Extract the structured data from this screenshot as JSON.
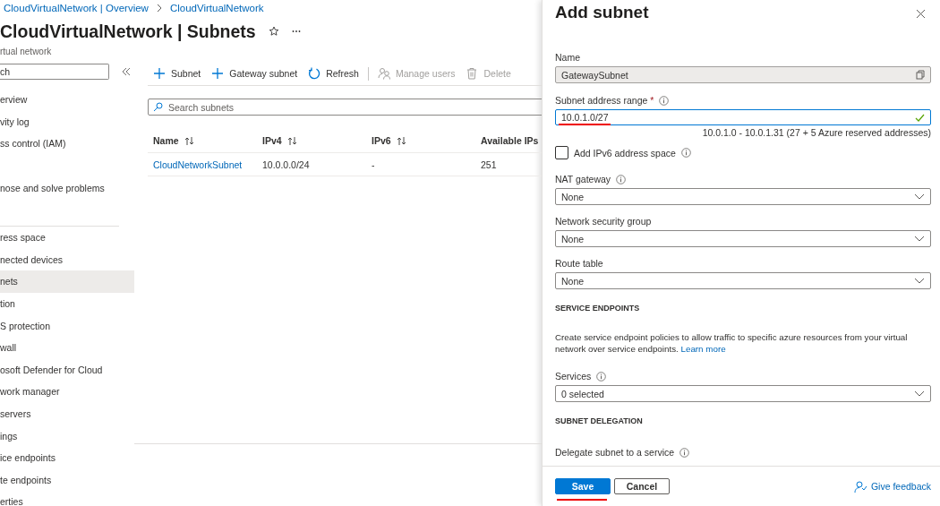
{
  "breadcrumb": [
    {
      "label": "CloudVirtualNetwork | Overview"
    },
    {
      "label": "CloudVirtualNetwork"
    }
  ],
  "page": {
    "title": "CloudVirtualNetwork | Subnets",
    "subtitle": "rtual network"
  },
  "sidebar": {
    "search": {
      "placeholder": "ch"
    },
    "groups": [
      [
        {
          "label": "erview",
          "selected": false
        },
        {
          "label": "vity log",
          "selected": false
        },
        {
          "label": "ss control (IAM)",
          "selected": false
        },
        {
          "label": "nose and solve problems",
          "selected": false
        }
      ],
      [
        {
          "label": "ress space",
          "selected": false
        },
        {
          "label": "nected devices",
          "selected": false
        },
        {
          "label": "nets",
          "selected": true
        },
        {
          "label": "tion",
          "selected": false
        },
        {
          "label": "S protection",
          "selected": false
        },
        {
          "label": "wall",
          "selected": false
        },
        {
          "label": "osoft Defender for Cloud",
          "selected": false
        },
        {
          "label": "work manager",
          "selected": false
        },
        {
          "label": " servers",
          "selected": false
        },
        {
          "label": "ings",
          "selected": false
        },
        {
          "label": "ice endpoints",
          "selected": false
        },
        {
          "label": "te endpoints",
          "selected": false
        },
        {
          "label": "erties",
          "selected": false
        }
      ]
    ]
  },
  "toolbar": [
    {
      "kind": "add",
      "label": "Subnet",
      "disabled": false
    },
    {
      "kind": "add",
      "label": "Gateway subnet",
      "disabled": false
    },
    {
      "kind": "refresh",
      "label": "Refresh",
      "disabled": false
    },
    {
      "kind": "users",
      "label": "Manage users",
      "disabled": true
    },
    {
      "kind": "delete",
      "label": "Delete",
      "disabled": true
    }
  ],
  "search": {
    "placeholder": "Search subnets"
  },
  "table": {
    "columns": [
      "Name",
      "IPv4",
      "IPv6",
      "Available IPs"
    ],
    "rows": [
      [
        "CloudNetworkSubnet",
        "10.0.0.0/24",
        "-",
        "251"
      ]
    ]
  },
  "panel": {
    "title": "Add subnet",
    "fields": [
      {
        "kind": "readonly",
        "label": "Name",
        "value": "GatewaySubnet"
      },
      {
        "kind": "text",
        "label": "Subnet address range",
        "required_mark": "*",
        "info": true,
        "value": "10.0.1.0/27",
        "valid": true,
        "marked": true,
        "hint": "10.0.1.0 - 10.0.1.31 (27 + 5 Azure reserved addresses)"
      },
      {
        "kind": "checkbox",
        "label": "Add IPv6 address space",
        "checked": false,
        "info": true
      },
      {
        "kind": "select",
        "label": "NAT gateway",
        "info": true,
        "value": "None"
      },
      {
        "kind": "select",
        "label": "Network security group",
        "info": false,
        "value": "None"
      },
      {
        "kind": "select",
        "label": "Route table",
        "info": false,
        "value": "None"
      },
      {
        "kind": "heading",
        "label": "SERVICE ENDPOINTS"
      },
      {
        "kind": "paragraph",
        "text": "Create service endpoint policies to allow traffic to specific azure resources from your virtual network over service endpoints.",
        "link": "Learn more"
      },
      {
        "kind": "select",
        "label": "Services",
        "info": true,
        "value": "0 selected"
      },
      {
        "kind": "heading",
        "label": "SUBNET DELEGATION"
      },
      {
        "kind": "label",
        "label": "Delegate subnet to a service",
        "info": true
      }
    ],
    "buttons": [
      {
        "kind": "primary",
        "label": "Save",
        "marked": true
      },
      {
        "kind": "secondary",
        "label": "Cancel",
        "marked": false
      }
    ],
    "feedback": "Give feedback"
  }
}
